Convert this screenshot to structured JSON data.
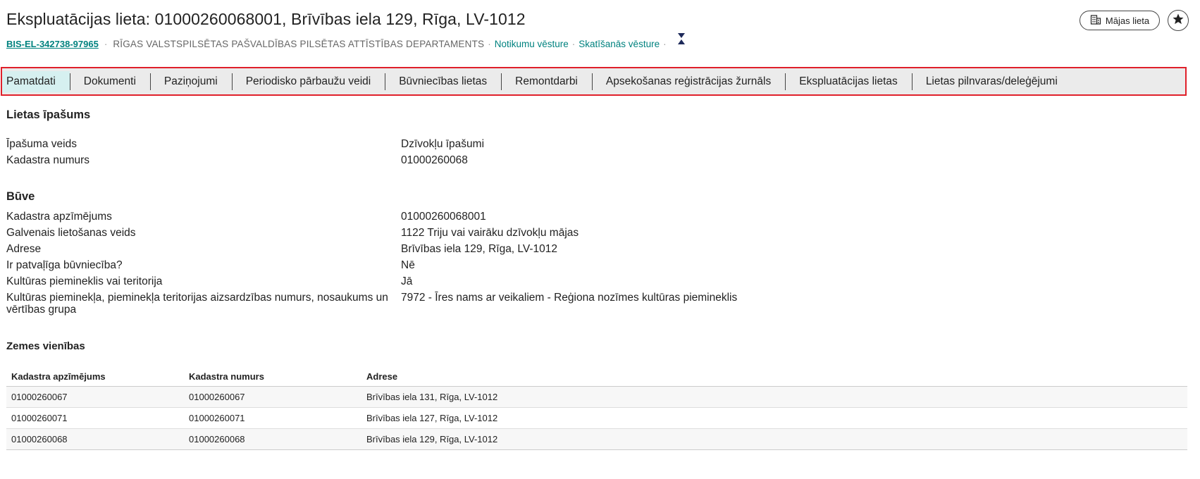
{
  "header": {
    "title": "Ekspluatācijas lieta: 01000260068001, Brīvības iela 129, Rīga, LV-1012",
    "case_id": "BIS-EL-342738-97965",
    "separator": "·",
    "department": "RĪGAS VALSTSPILSĒTAS PAŠVALDĪBAS PILSĒTAS ATTĪSTĪBAS DEPARTAMENTS",
    "dot": "·",
    "event_history": "Notikumu vēsture",
    "view_history": "Skatīšanās vēsture",
    "house_case_button": "Mājas lieta"
  },
  "tabs": [
    {
      "label": "Pamatdati"
    },
    {
      "label": "Dokumenti"
    },
    {
      "label": "Paziņojumi"
    },
    {
      "label": "Periodisko pārbaužu veidi"
    },
    {
      "label": "Būvniecības lietas"
    },
    {
      "label": "Remontdarbi"
    },
    {
      "label": "Apsekošanas reģistrācijas žurnāls"
    },
    {
      "label": "Ekspluatācijas lietas"
    },
    {
      "label": "Lietas pilnvaras/deleģējumi"
    }
  ],
  "property": {
    "title": "Lietas īpašums",
    "rows": [
      {
        "label": "Īpašuma veids",
        "value": "Dzīvokļu īpašumi"
      },
      {
        "label": "Kadastra numurs",
        "value": "01000260068"
      }
    ]
  },
  "building": {
    "title": "Būve",
    "rows": [
      {
        "label": "Kadastra apzīmējums",
        "value": "01000260068001"
      },
      {
        "label": "Galvenais lietošanas veids",
        "value": "1122 Triju vai vairāku dzīvokļu mājas"
      },
      {
        "label": "Adrese",
        "value": "Brīvības iela 129, Rīga, LV-1012"
      },
      {
        "label": "Ir patvaļīga būvniecība?",
        "value": "Nē"
      },
      {
        "label": "Kultūras piemineklis vai teritorija",
        "value": "Jā"
      },
      {
        "label": "Kultūras pieminekļa, pieminekļa teritorijas aizsardzības numurs, nosaukums un vērtības grupa",
        "value": "7972 - Īres nams ar veikaliem - Reģiona nozīmes kultūras piemineklis"
      }
    ]
  },
  "land_units": {
    "title": "Zemes vienības",
    "columns": [
      "Kadastra apzīmējums",
      "Kadastra numurs",
      "Adrese"
    ],
    "rows": [
      [
        "01000260067",
        "01000260067",
        "Brīvības iela 131, Rīga, LV-1012"
      ],
      [
        "01000260071",
        "01000260071",
        "Brīvības iela 127, Rīga, LV-1012"
      ],
      [
        "01000260068",
        "01000260068",
        "Brīvības iela 129, Rīga, LV-1012"
      ]
    ]
  }
}
